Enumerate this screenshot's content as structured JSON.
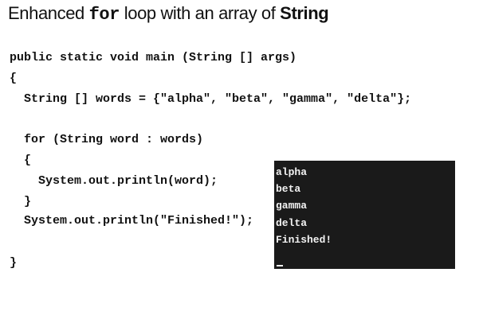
{
  "title": {
    "prefix": "Enhanced ",
    "keyword": "for",
    "middle": " loop with an array of ",
    "emphasis": "String"
  },
  "code_lines": [
    "public static void main (String [] args)",
    "{",
    "  String [] words = {\"alpha\", \"beta\", \"gamma\", \"delta\"};",
    "  for (String word : words)",
    "  {",
    "    System.out.println(word);",
    "  }",
    "  System.out.println(\"Finished!\");",
    "}"
  ],
  "console": {
    "lines": [
      "alpha",
      "beta",
      "gamma",
      "delta",
      "Finished!"
    ],
    "cursor": "_"
  }
}
